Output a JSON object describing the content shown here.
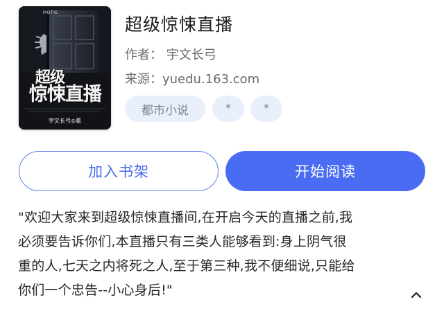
{
  "book": {
    "cover": {
      "publisher": "MOTIE",
      "title_line1": "超级",
      "title_line2": "惊悚直播",
      "author": "宇文长弓◎著"
    },
    "title": "超级惊悚直播",
    "author_line": "作者： 宇文长弓",
    "source_line": "来源：yuedu.163.com",
    "tags": [
      "都市小说",
      "*",
      "*"
    ]
  },
  "actions": {
    "add_to_shelf": "加入书架",
    "start_reading": "开始阅读"
  },
  "description": {
    "lines": [
      "\"欢迎大家来到超级惊悚直播间,在开启今天的直播之前,我",
      "必须要告诉你们,本直播只有三类人能够看到:身上阴气很",
      "重的人,七天之内将死之人,至于第三种,我不便细说,只能给",
      "你们一个忠告--小心身后!\""
    ]
  },
  "colors": {
    "accent": "#4a6cf3",
    "tag_bg": "#eaf0fb",
    "tag_text": "#7a8596",
    "meta_text": "#6b6b6b"
  },
  "icons": {
    "collapse": "chevron-up-icon"
  }
}
